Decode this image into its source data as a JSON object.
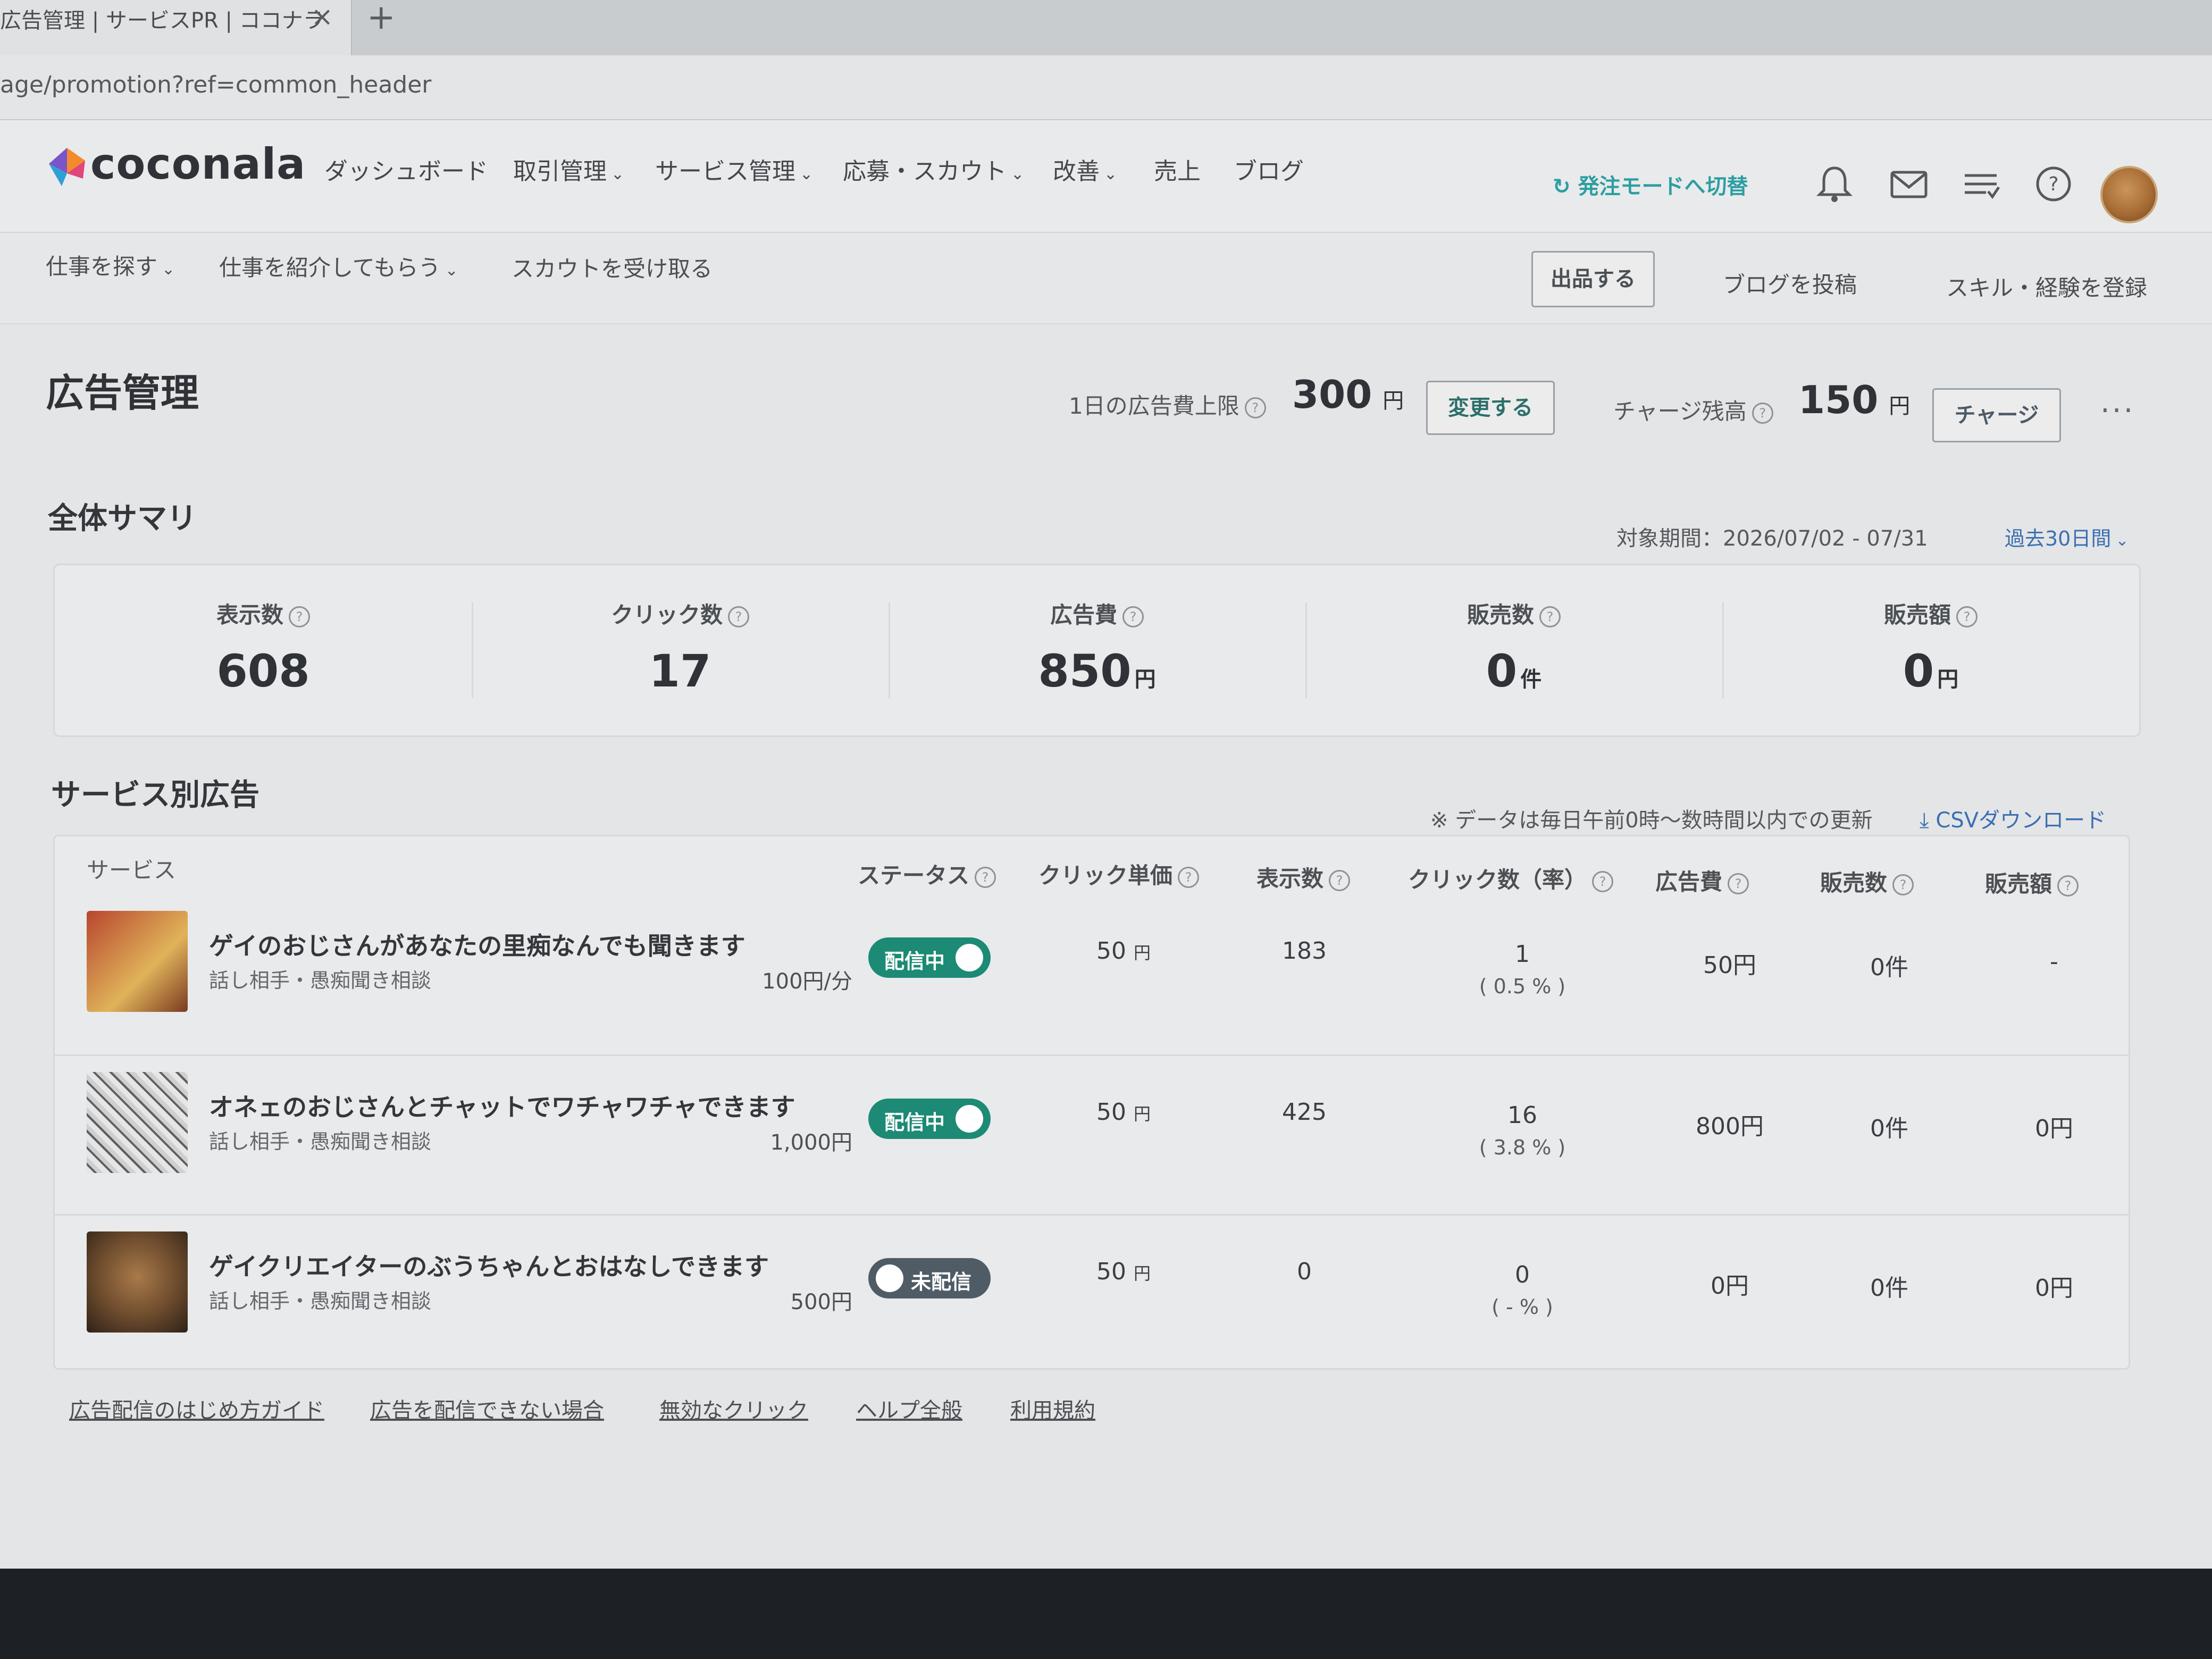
{
  "browser": {
    "tab_title": "広告管理 | サービスPR | ココナラ",
    "tab_close": "×",
    "tab_new": "+",
    "url": "age/promotion?ref=common_header"
  },
  "header": {
    "logo_text": "coconala",
    "nav": [
      "ダッシュボード",
      "取引管理",
      "サービス管理",
      "応募・スカウト",
      "改善",
      "売上",
      "ブログ"
    ],
    "switch_mode": "発注モードへ切替",
    "icons": [
      "bell-icon",
      "mail-icon",
      "list-icon",
      "help-icon"
    ]
  },
  "subnav": {
    "items": [
      "仕事を探す",
      "仕事を紹介してもらう",
      "スカウトを受け取る"
    ],
    "publish_button": "出品する",
    "blog_post": "ブログを投稿",
    "skills": "スキル・経験を登録"
  },
  "page": {
    "title": "広告管理",
    "budget_label": "1日の広告費上限",
    "budget_value": "300",
    "budget_unit": "円",
    "change_button": "変更する",
    "charge_label": "チャージ残高",
    "charge_value": "150",
    "charge_unit": "円",
    "charge_button": "チャージ",
    "more": "···"
  },
  "summary": {
    "title": "全体サマリ",
    "period": "対象期間：2026/07/02 - 07/31",
    "period_select": "過去30日間",
    "metrics": [
      {
        "label": "表示数",
        "value": "608",
        "unit": ""
      },
      {
        "label": "クリック数",
        "value": "17",
        "unit": ""
      },
      {
        "label": "広告費",
        "value": "850",
        "unit": "円"
      },
      {
        "label": "販売数",
        "value": "0",
        "unit": "件"
      },
      {
        "label": "販売額",
        "value": "0",
        "unit": "円"
      }
    ]
  },
  "services": {
    "title": "サービス別広告",
    "note": "※ データは毎日午前0時〜数時間以内での更新",
    "csv": "CSVダウンロード",
    "headers": [
      "サービス",
      "ステータス",
      "クリック単価",
      "表示数",
      "クリック数（率）",
      "広告費",
      "販売数",
      "販売額"
    ],
    "rows": [
      {
        "title": "ゲイのおじさんがあなたの里痴なんでも聞きます",
        "category": "話し相手・愚痴聞き相談",
        "price": "100円/分",
        "status": "配信中",
        "status_on": true,
        "cpc": "50",
        "cpc_unit": "円",
        "impressions": "183",
        "clicks": "1",
        "rate": "( 0.5 % )",
        "cost": "50円",
        "sales": "0件",
        "revenue": "-",
        "thumb_color": "#b8462e"
      },
      {
        "title": "オネェのおじさんとチャットでワチャワチャできます",
        "category": "話し相手・愚痴聞き相談",
        "price": "1,000円",
        "status": "配信中",
        "status_on": true,
        "cpc": "50",
        "cpc_unit": "円",
        "impressions": "425",
        "clicks": "16",
        "rate": "( 3.8 % )",
        "cost": "800円",
        "sales": "0件",
        "revenue": "0円",
        "thumb_color": "#9a9c9e"
      },
      {
        "title": "ゲイクリエイターのぶうちゃんとおはなしできます",
        "category": "話し相手・愚痴聞き相談",
        "price": "500円",
        "status": "未配信",
        "status_on": false,
        "cpc": "50",
        "cpc_unit": "円",
        "impressions": "0",
        "clicks": "0",
        "rate": "( - % )",
        "cost": "0円",
        "sales": "0件",
        "revenue": "0円",
        "thumb_color": "#6b4a2c"
      }
    ]
  },
  "footer_links": [
    "広告配信のはじめ方ガイド",
    "広告を配信できない場合",
    "無効なクリック",
    "ヘルプ全般",
    "利用規約"
  ],
  "colors": {
    "accent": "#2c9ea2",
    "toggle_on": "#1c8a74",
    "toggle_off": "#4f5c66",
    "link": "#3b6fb3"
  }
}
